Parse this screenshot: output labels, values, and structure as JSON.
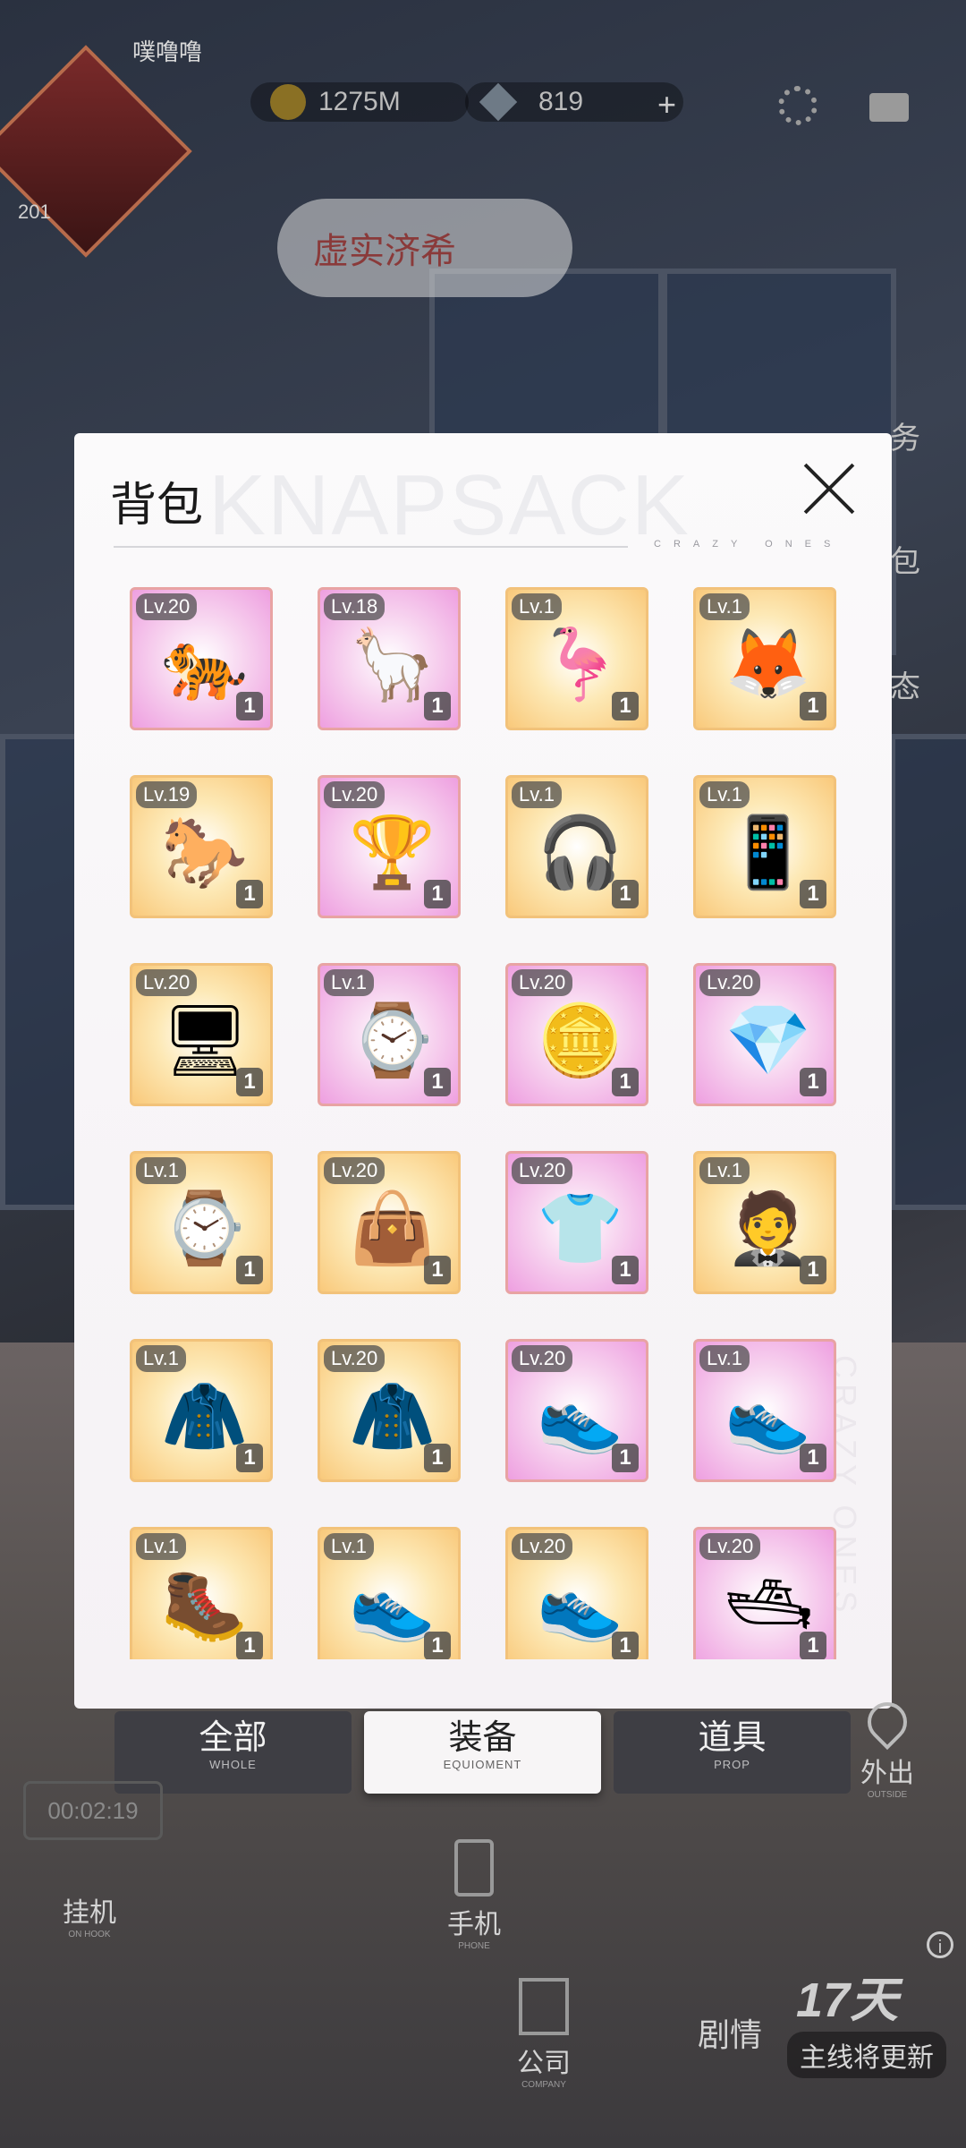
{
  "hud": {
    "player_name": "噗噜噜",
    "level": "201",
    "gold": "1275M",
    "diamonds": "819",
    "plus": "+",
    "banner": "虚实济希"
  },
  "side": {
    "right_labels": [
      "务",
      "包",
      "态"
    ],
    "outing": "外出",
    "outing_en": "OUTSIDE"
  },
  "modal": {
    "title": "背包",
    "watermark": "KNAPSACK",
    "brand": "CRAZY ONES",
    "vertical_brand": "CRAZY ONES"
  },
  "items": [
    {
      "level": "Lv.20",
      "qty": "1",
      "bg": "pink",
      "icon": "tiger-icon"
    },
    {
      "level": "Lv.18",
      "qty": "1",
      "bg": "pink",
      "icon": "alpaca-icon"
    },
    {
      "level": "Lv.1",
      "qty": "1",
      "bg": "gold",
      "icon": "flamingo-icon"
    },
    {
      "level": "Lv.1",
      "qty": "1",
      "bg": "gold",
      "icon": "fennec-fox-icon"
    },
    {
      "level": "Lv.19",
      "qty": "1",
      "bg": "gold",
      "icon": "white-horse-icon"
    },
    {
      "level": "Lv.20",
      "qty": "1",
      "bg": "pink",
      "icon": "trophy-vase-icon"
    },
    {
      "level": "Lv.1",
      "qty": "1",
      "bg": "gold",
      "icon": "headphones-icon"
    },
    {
      "level": "Lv.1",
      "qty": "1",
      "bg": "gold",
      "icon": "smartphone-icon"
    },
    {
      "level": "Lv.20",
      "qty": "1",
      "bg": "gold",
      "icon": "gaming-pc-icon"
    },
    {
      "level": "Lv.1",
      "qty": "1",
      "bg": "pink",
      "icon": "jewel-watch-box-icon"
    },
    {
      "level": "Lv.20",
      "qty": "1",
      "bg": "pink",
      "icon": "gold-bars-icon"
    },
    {
      "level": "Lv.20",
      "qty": "1",
      "bg": "pink",
      "icon": "heart-necklace-icon"
    },
    {
      "level": "Lv.1",
      "qty": "1",
      "bg": "gold",
      "icon": "wristwatch-icon"
    },
    {
      "level": "Lv.20",
      "qty": "1",
      "bg": "gold",
      "icon": "handbag-icon"
    },
    {
      "level": "Lv.20",
      "qty": "1",
      "bg": "pink",
      "icon": "jersey-icon"
    },
    {
      "level": "Lv.1",
      "qty": "1",
      "bg": "gold",
      "icon": "suit-icon"
    },
    {
      "level": "Lv.1",
      "qty": "1",
      "bg": "gold",
      "icon": "trench-coat-icon"
    },
    {
      "level": "Lv.20",
      "qty": "1",
      "bg": "gold",
      "icon": "leather-jacket-icon"
    },
    {
      "level": "Lv.20",
      "qty": "1",
      "bg": "pink",
      "icon": "sneaker-icon"
    },
    {
      "level": "Lv.1",
      "qty": "1",
      "bg": "pink",
      "icon": "gold-sneaker-icon"
    },
    {
      "level": "Lv.1",
      "qty": "1",
      "bg": "gold",
      "icon": "black-boots-icon"
    },
    {
      "level": "Lv.1",
      "qty": "1",
      "bg": "gold",
      "icon": "high-top-sneaker-icon"
    },
    {
      "level": "Lv.20",
      "qty": "1",
      "bg": "gold",
      "icon": "chunky-sneaker-icon"
    },
    {
      "level": "Lv.20",
      "qty": "1",
      "bg": "pink",
      "icon": "yacht-icon"
    }
  ],
  "tabs": [
    {
      "zh": "全部",
      "en": "WHOLE"
    },
    {
      "zh": "装备",
      "en": "EQUIOMENT"
    },
    {
      "zh": "道具",
      "en": "PROP"
    }
  ],
  "bottom": {
    "timer": "00:02:19",
    "idle": "挂机",
    "idle_en": "ON HOOK",
    "phone": "手机",
    "phone_en": "PHONE",
    "company": "公司",
    "company_en": "COMPANY",
    "story": "剧情",
    "countdown": "17天",
    "notice": "主线将更新"
  }
}
